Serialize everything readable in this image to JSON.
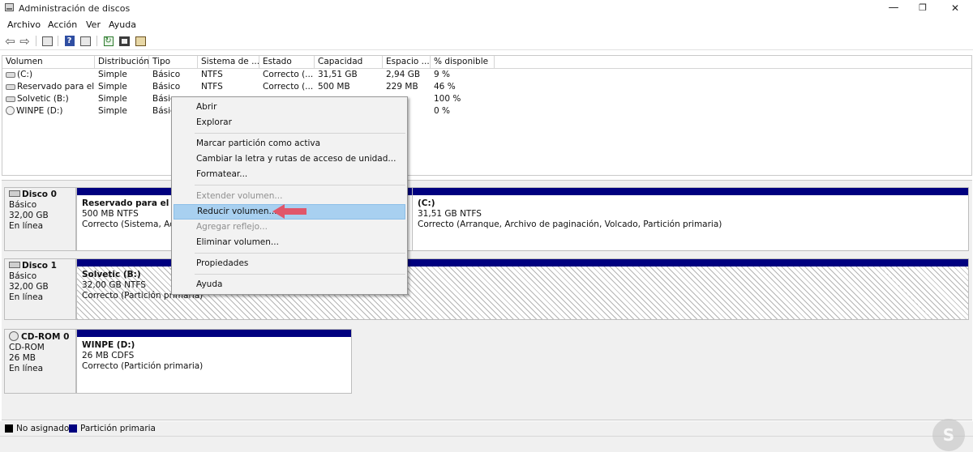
{
  "window": {
    "title": "Administración de discos",
    "minimize": "—",
    "maximize": "❐",
    "close": "✕"
  },
  "menubar": [
    "Archivo",
    "Acción",
    "Ver",
    "Ayuda"
  ],
  "toolbar": {
    "icons": [
      "back-arrow-icon",
      "forward-arrow-icon",
      "disk-list-icon",
      "help-icon",
      "disk-view-icon",
      "refresh-icon",
      "check-disk-icon",
      "properties-icon"
    ],
    "back_glyph": "⇦",
    "forward_glyph": "⇨",
    "help_glyph": "?",
    "refresh_glyph": "↻"
  },
  "volume_list": {
    "columns": [
      "Volumen",
      "Distribución",
      "Tipo",
      "Sistema de ...",
      "Estado",
      "Capacidad",
      "Espacio ...",
      "% disponible"
    ],
    "rows": [
      {
        "icon": "drive-icon",
        "volume": "(C:)",
        "layout": "Simple",
        "type": "Básico",
        "fs": "NTFS",
        "status": "Correcto (...",
        "capacity": "31,51 GB",
        "free": "2,94 GB",
        "pct": "9 %"
      },
      {
        "icon": "drive-icon",
        "volume": "Reservado para el ...",
        "layout": "Simple",
        "type": "Básico",
        "fs": "NTFS",
        "status": "Correcto (...",
        "capacity": "500 MB",
        "free": "229 MB",
        "pct": "46 %"
      },
      {
        "icon": "drive-icon",
        "volume": "Solvetic (B:)",
        "layout": "Simple",
        "type": "Básic",
        "fs": "",
        "status": "",
        "capacity": "",
        "free": "",
        "pct": "100 %"
      },
      {
        "icon": "cdrom-icon",
        "volume": "WINPE (D:)",
        "layout": "Simple",
        "type": "Básic",
        "fs": "",
        "status": "",
        "capacity": "",
        "free": "",
        "pct": "0 %"
      }
    ]
  },
  "disks": [
    {
      "name": "Disco 0",
      "type": "Básico",
      "size": "32,00 GB",
      "state": "En línea",
      "partitions": [
        {
          "name": "Reservado para el siste",
          "size": "500 MB NTFS",
          "status": "Correcto (Sistema, Activ"
        },
        {
          "name": "(C:)",
          "size": "31,51 GB NTFS",
          "status": "Correcto (Arranque, Archivo de paginación, Volcado, Partición primaria)"
        }
      ]
    },
    {
      "name": "Disco 1",
      "type": "Básico",
      "size": "32,00 GB",
      "state": "En línea",
      "partitions": [
        {
          "name": "Solvetic  (B:)",
          "size": "32,00 GB NTFS",
          "status": "Correcto (Partición primaria)"
        }
      ]
    },
    {
      "name": "CD-ROM 0",
      "type": "CD-ROM",
      "size": "26 MB",
      "state": "En línea",
      "partitions": [
        {
          "name": "WINPE  (D:)",
          "size": "26 MB CDFS",
          "status": "Correcto (Partición primaria)"
        }
      ]
    }
  ],
  "legend": [
    {
      "label": "No asignado",
      "color": "#000000"
    },
    {
      "label": "Partición primaria",
      "color": "#00007f"
    }
  ],
  "context_menu": {
    "items": [
      {
        "label": "Abrir",
        "disabled": false
      },
      {
        "label": "Explorar",
        "disabled": false
      },
      {
        "label": "Marcar partición como activa",
        "disabled": false
      },
      {
        "label": "Cambiar la letra y rutas de acceso de unidad...",
        "disabled": false
      },
      {
        "label": "Formatear...",
        "disabled": false
      },
      {
        "label": "Extender volumen...",
        "disabled": true
      },
      {
        "label": "Reducir volumen...",
        "disabled": false,
        "highlighted": true
      },
      {
        "label": "Agregar reflejo...",
        "disabled": true
      },
      {
        "label": "Eliminar volumen...",
        "disabled": false
      },
      {
        "label": "Propiedades",
        "disabled": false
      },
      {
        "label": "Ayuda",
        "disabled": false
      }
    ]
  },
  "annotation": {
    "arrow_color": "#e0566a"
  },
  "watermark": {
    "glyph": "S"
  },
  "colors": {
    "primary_partition": "#00007f",
    "menu_highlight": "#a8d0f0",
    "disk_area_bg": "#f0f0f0"
  }
}
